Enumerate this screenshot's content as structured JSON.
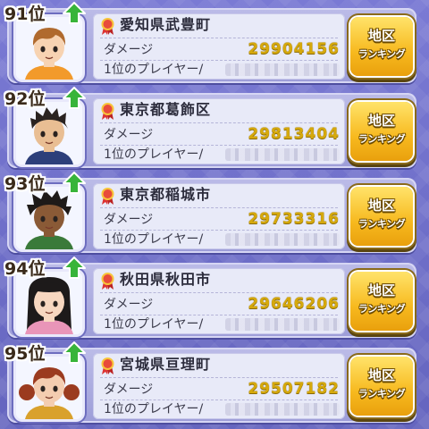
{
  "list_title": "",
  "damage_label": "ダメージ",
  "top_player_label": "1位のプレイヤー/",
  "button_label_line1": "地区",
  "button_label_line2": "ランキング",
  "rank_change_icon": "green-up-arrow-icon",
  "medal_icon": "red-ribbon-medal-icon",
  "colors": {
    "background": "#6f6fc8",
    "row": "#b0b0e2",
    "card": "#e8eaf8",
    "damage_value": "#d6a90c",
    "button": "#f7b91e",
    "arrow": "#38b43a"
  },
  "rows": [
    {
      "rank": "91位",
      "region": "愛知県武豊町",
      "damage": "29904156",
      "avatar": {
        "skin": "#f7d3b2",
        "hair": "#b06a2e",
        "shirt": "#f29a2b",
        "style": "short"
      }
    },
    {
      "rank": "92位",
      "region": "東京都葛飾区",
      "damage": "29813404",
      "avatar": {
        "skin": "#e9be93",
        "hair": "#2a2320",
        "shirt": "#2d3f7a",
        "style": "spiky"
      }
    },
    {
      "rank": "93位",
      "region": "東京都稲城市",
      "damage": "29733316",
      "avatar": {
        "skin": "#8a5a36",
        "hair": "#1e1a18",
        "shirt": "#3a7a3a",
        "style": "dreads"
      }
    },
    {
      "rank": "94位",
      "region": "秋田県秋田市",
      "damage": "29646206",
      "avatar": {
        "skin": "#f7d7c0",
        "hair": "#1d1a1a",
        "shirt": "#e995b8",
        "style": "long"
      }
    },
    {
      "rank": "95位",
      "region": "宮城県亘理町",
      "damage": "29507182",
      "avatar": {
        "skin": "#f4cdb0",
        "hair": "#9b3b1f",
        "shirt": "#d9a12c",
        "style": "pigtails"
      }
    }
  ]
}
